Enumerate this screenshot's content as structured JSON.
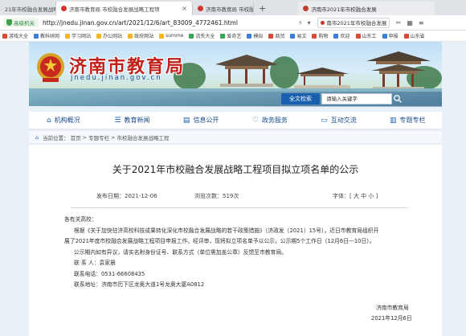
{
  "browser": {
    "tabs": [
      {
        "label": "21年市校融合发展战略"
      },
      {
        "label": "济南市教育局 市校融合发展战略工程项"
      },
      {
        "label": "济南市教育局 市校融合发展战"
      }
    ],
    "right_tab": "济南市2021年市校融合发展",
    "secure_label": "高级机关",
    "url": "http://jnedu.jinan.gov.cn/art/2021/12/6/art_83009_4772461.html",
    "search_mini": "南市2021年市校融合发展",
    "bookmarks": [
      {
        "label": "游戏大全",
        "color": "red"
      },
      {
        "label": "教科研网",
        "color": "blue"
      },
      {
        "label": "学习网站",
        "color": "yellow"
      },
      {
        "label": "办公网站",
        "color": "yellow"
      },
      {
        "label": "政府网站",
        "color": "yellow"
      },
      {
        "label": "summe",
        "color": "yellow"
      },
      {
        "label": "流失大全",
        "color": "green"
      },
      {
        "label": "爱奇艺",
        "color": "green"
      },
      {
        "label": "模拟",
        "color": "blue"
      },
      {
        "label": "商贸",
        "color": "red"
      },
      {
        "label": "易文",
        "color": "blue"
      },
      {
        "label": "购物",
        "color": "red"
      },
      {
        "label": "欢迎",
        "color": "blue"
      },
      {
        "label": "山东工",
        "color": "red"
      },
      {
        "label": "申报",
        "color": "blue"
      },
      {
        "label": "山东省",
        "color": "red"
      }
    ]
  },
  "site": {
    "logo_text": "济南市教育局",
    "logo_url": "jnedu.jinan.gov.cn",
    "search_button": "全文检索",
    "search_placeholder": "请输入关键字",
    "nav": [
      {
        "label": "机构概况",
        "icon": "home-icon"
      },
      {
        "label": "教育新闻",
        "icon": "news-icon"
      },
      {
        "label": "信息公开",
        "icon": "info-icon"
      },
      {
        "label": "政务服务",
        "icon": "heart-icon"
      },
      {
        "label": "互动交流",
        "icon": "chat-icon"
      },
      {
        "label": "专题专栏",
        "icon": "doc-icon"
      }
    ],
    "breadcrumb": {
      "prefix": "当前位置：",
      "items": [
        "首页",
        "专题专栏",
        "市校融合发展战略工程"
      ]
    }
  },
  "article": {
    "title": "关于2021年市校融合发展战略工程项目拟立项名单的公示",
    "publish_date": "发布日期：2021-12-06",
    "views": "浏览次数：519次",
    "font_size": "字体：[ 大 中 小 ]",
    "salutation": "各有关高校：",
    "paragraph1_line1": "根据《关于加快驻济高校科技成果转化深化市校融合发展战略的若干政策措施》（济政发〔2021〕15号），近日市教育局组织开",
    "paragraph1_line2": "展了2021年度市校融合发展战略工程项目申报工作。经评审，现将拟立项名单予以公示，公示期5个工作日（12月6日—10日）。",
    "paragraph2": "公示期内如有异议，请实名附身份证号、联系方式（单位需加盖公章）反馈至市教育局。",
    "contact": "联 系 人：袁家晨",
    "phone": "联系电话：0531-66608435",
    "address": "联系地址：济南市历下区龙奥大道1号龙奥大厦A0812",
    "signature_org": "济南市教育局",
    "signature_date": "2021年12月6日"
  },
  "colors": {
    "accent": "#1a5fae",
    "logo_red": "#c0201a",
    "page_bg": "#eaf0f8"
  }
}
